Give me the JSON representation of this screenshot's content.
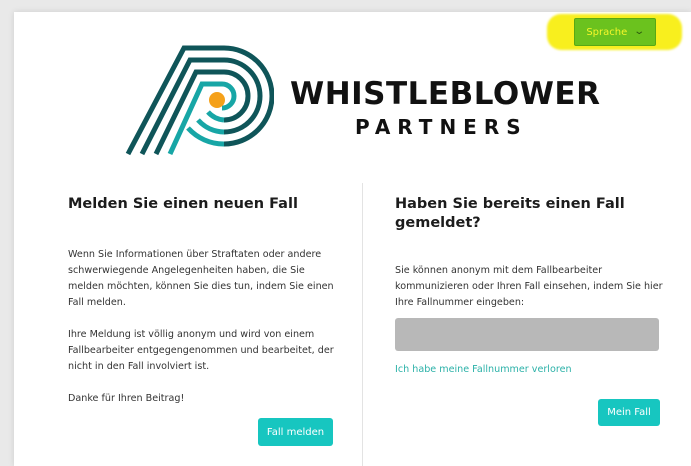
{
  "header": {
    "language_button": "Sprache",
    "chevron_icon": "chevron-down-icon",
    "highlight_color": "#f8ef1e"
  },
  "brand": {
    "line1": "WHISTLEBLOWER",
    "line2": "PARTNERS",
    "colors": {
      "dark": "#0f5559",
      "teal": "#17a6a6",
      "dot": "#f5a11a"
    }
  },
  "left": {
    "title": "Melden Sie einen neuen Fall",
    "paragraphs": [
      "Wenn Sie Informationen über Straftaten oder andere schwerwiegende Angelegenheiten haben, die Sie melden möchten, können Sie dies tun, indem Sie einen Fall melden.",
      "Ihre Meldung ist völlig anonym und wird von einem Fallbearbeiter entgegengenommen und bearbeitet, der nicht in den Fall involviert ist.",
      "Danke für Ihren Beitrag!"
    ],
    "button": "Fall melden"
  },
  "right": {
    "title": "Haben Sie bereits einen Fall gemeldet?",
    "text": "Sie können anonym mit dem Fallbearbeiter kommunizieren oder Ihren Fall einsehen, indem Sie hier Ihre Fallnummer eingeben:",
    "input_value": "",
    "lost_link": "Ich habe meine Fallnummer verloren",
    "button": "Mein Fall"
  },
  "accent_colors": {
    "teal_button": "#17c6c0",
    "language_button": "#6bc21e"
  }
}
